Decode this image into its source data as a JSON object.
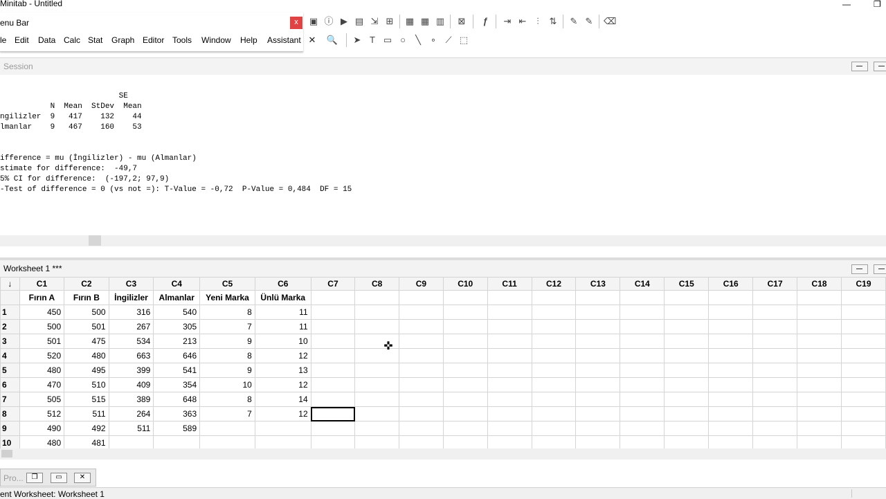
{
  "window": {
    "title": "Minitab - Untitled"
  },
  "menubar": {
    "caption": "enu Bar",
    "close_glyph": "x",
    "menus": [
      "le",
      "Edit",
      "Data",
      "Calc",
      "Stat",
      "Graph",
      "Editor",
      "Tools",
      "Window",
      "Help",
      "Assistant"
    ]
  },
  "session": {
    "title": "Session",
    "output": [
      "                          SE",
      "           N  Mean  StDev  Mean",
      "ngilizler  9   417    132    44",
      "lmanlar    9   467    160    53",
      "",
      "",
      "ifference = mu (İngilizler) - mu (Almanlar)",
      "stimate for difference:  -49,7",
      "5% CI for difference:  (-197,2; 97,9)",
      "-Test of difference = 0 (vs not =): T-Value = -0,72  P-Value = 0,484  DF = 15"
    ]
  },
  "worksheet": {
    "title": "Worksheet 1 ***",
    "corner_glyph": "↓",
    "columns": [
      "C1",
      "C2",
      "C3",
      "C4",
      "C5",
      "C6",
      "C7",
      "C8",
      "C9",
      "C10",
      "C11",
      "C12",
      "C13",
      "C14",
      "C15",
      "C16",
      "C17",
      "C18",
      "C19"
    ],
    "names": [
      "Fırın A",
      "Fırın B",
      "İngilizler",
      "Almanlar",
      "Yeni Marka",
      "Ünlü Marka",
      "",
      "",
      "",
      "",
      "",
      "",
      "",
      "",
      "",
      "",
      "",
      "",
      ""
    ],
    "rows": [
      [
        "1",
        "450",
        "500",
        "316",
        "540",
        "8",
        "11"
      ],
      [
        "2",
        "500",
        "501",
        "267",
        "305",
        "7",
        "11"
      ],
      [
        "3",
        "501",
        "475",
        "534",
        "213",
        "9",
        "10"
      ],
      [
        "4",
        "520",
        "480",
        "663",
        "646",
        "8",
        "12"
      ],
      [
        "5",
        "480",
        "495",
        "399",
        "541",
        "9",
        "13"
      ],
      [
        "6",
        "470",
        "510",
        "409",
        "354",
        "10",
        "12"
      ],
      [
        "7",
        "505",
        "515",
        "389",
        "648",
        "8",
        "14"
      ],
      [
        "8",
        "512",
        "511",
        "264",
        "363",
        "7",
        "12"
      ],
      [
        "9",
        "490",
        "492",
        "511",
        "589",
        "",
        ""
      ],
      [
        "10",
        "480",
        "481",
        "",
        "",
        "",
        ""
      ]
    ]
  },
  "project_manager": {
    "title": "Pro..."
  },
  "status": {
    "text": "ent Worksheet: Worksheet 1"
  },
  "colors": {
    "close": "#e04343",
    "grid_border": "#d4d4d4",
    "header_bg": "#f4f4f4"
  },
  "icons": [
    "minimize-icon",
    "maximize-icon",
    "close-icon",
    "crosshair-cursor-icon"
  ]
}
